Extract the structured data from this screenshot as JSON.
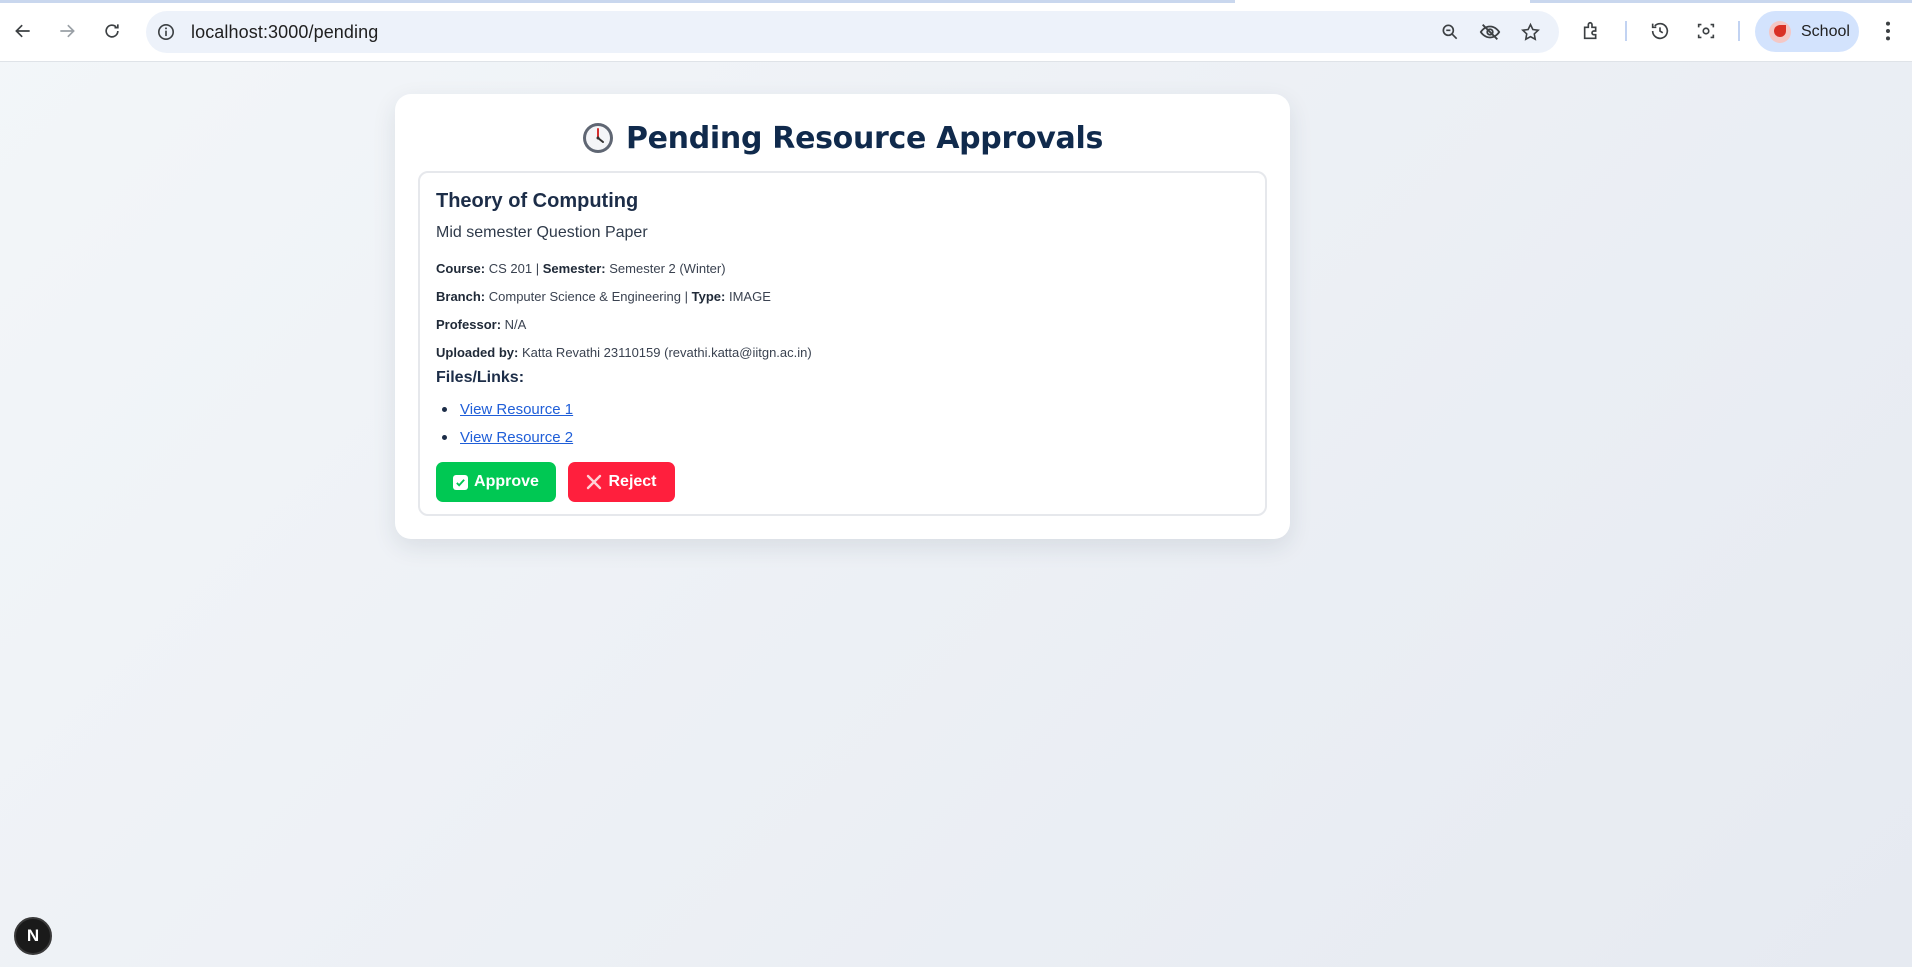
{
  "browser": {
    "url": "localhost:3000/pending",
    "profile_label": "School"
  },
  "page": {
    "title": "Pending Resource Approvals"
  },
  "resource": {
    "title": "Theory of Computing",
    "description": "Mid semester Question Paper",
    "course_label": "Course:",
    "course_value": "CS 201",
    "semester_label": "Semester:",
    "semester_value": "Semester 2 (Winter)",
    "branch_label": "Branch:",
    "branch_value": "Computer Science & Engineering",
    "type_label": "Type:",
    "type_value": "IMAGE",
    "professor_label": "Professor:",
    "professor_value": "N/A",
    "uploaded_label": "Uploaded by:",
    "uploaded_value": "Katta Revathi 23110159 (revathi.katta@iitgn.ac.in)",
    "separator": "|",
    "files_label": "Files/Links:",
    "files": [
      "View Resource 1",
      "View Resource 2"
    ]
  },
  "actions": {
    "approve_label": "Approve",
    "reject_label": "Reject"
  },
  "badge": {
    "label": "N"
  },
  "colors": {
    "heading": "#102a4c",
    "approve": "#00c853",
    "reject": "#ff1f3d",
    "link": "#1f5ed8"
  }
}
